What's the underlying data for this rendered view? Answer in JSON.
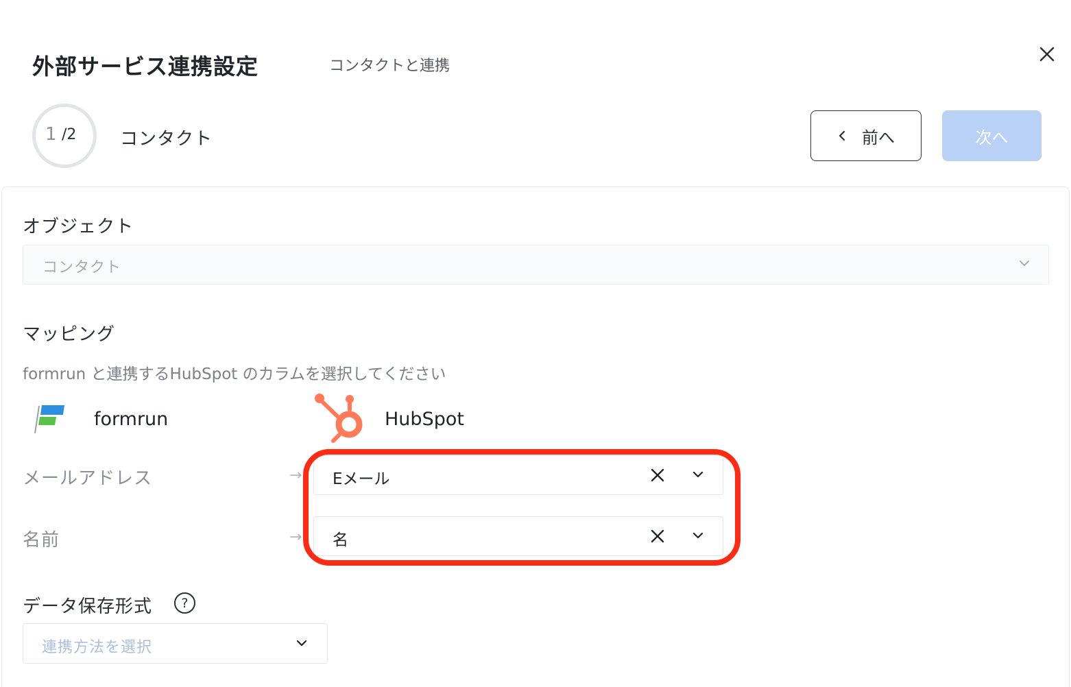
{
  "header": {
    "title": "外部サービス連携設定",
    "subtitle": "コンタクトと連携"
  },
  "stepper": {
    "current": "1",
    "total": "/2",
    "label": "コンタクト"
  },
  "nav": {
    "prev_label": "前へ",
    "next_label": "次へ",
    "next_disabled_color": "#b9d1f4"
  },
  "object_section": {
    "label": "オブジェクト",
    "selected": "コンタクト"
  },
  "mapping_section": {
    "label": "マッピング",
    "description": "formrun と連携するHubSpot のカラムを選択してください",
    "source_name": "formrun",
    "target_name": "HubSpot",
    "rows": [
      {
        "source": "メールアドレス",
        "target": "Eメール"
      },
      {
        "source": "名前",
        "target": "名"
      }
    ]
  },
  "storage_section": {
    "label": "データ保存形式",
    "placeholder": "連携方法を選択"
  },
  "colors": {
    "highlight": "#ff2a12",
    "hubspot": "#ff7a59"
  }
}
